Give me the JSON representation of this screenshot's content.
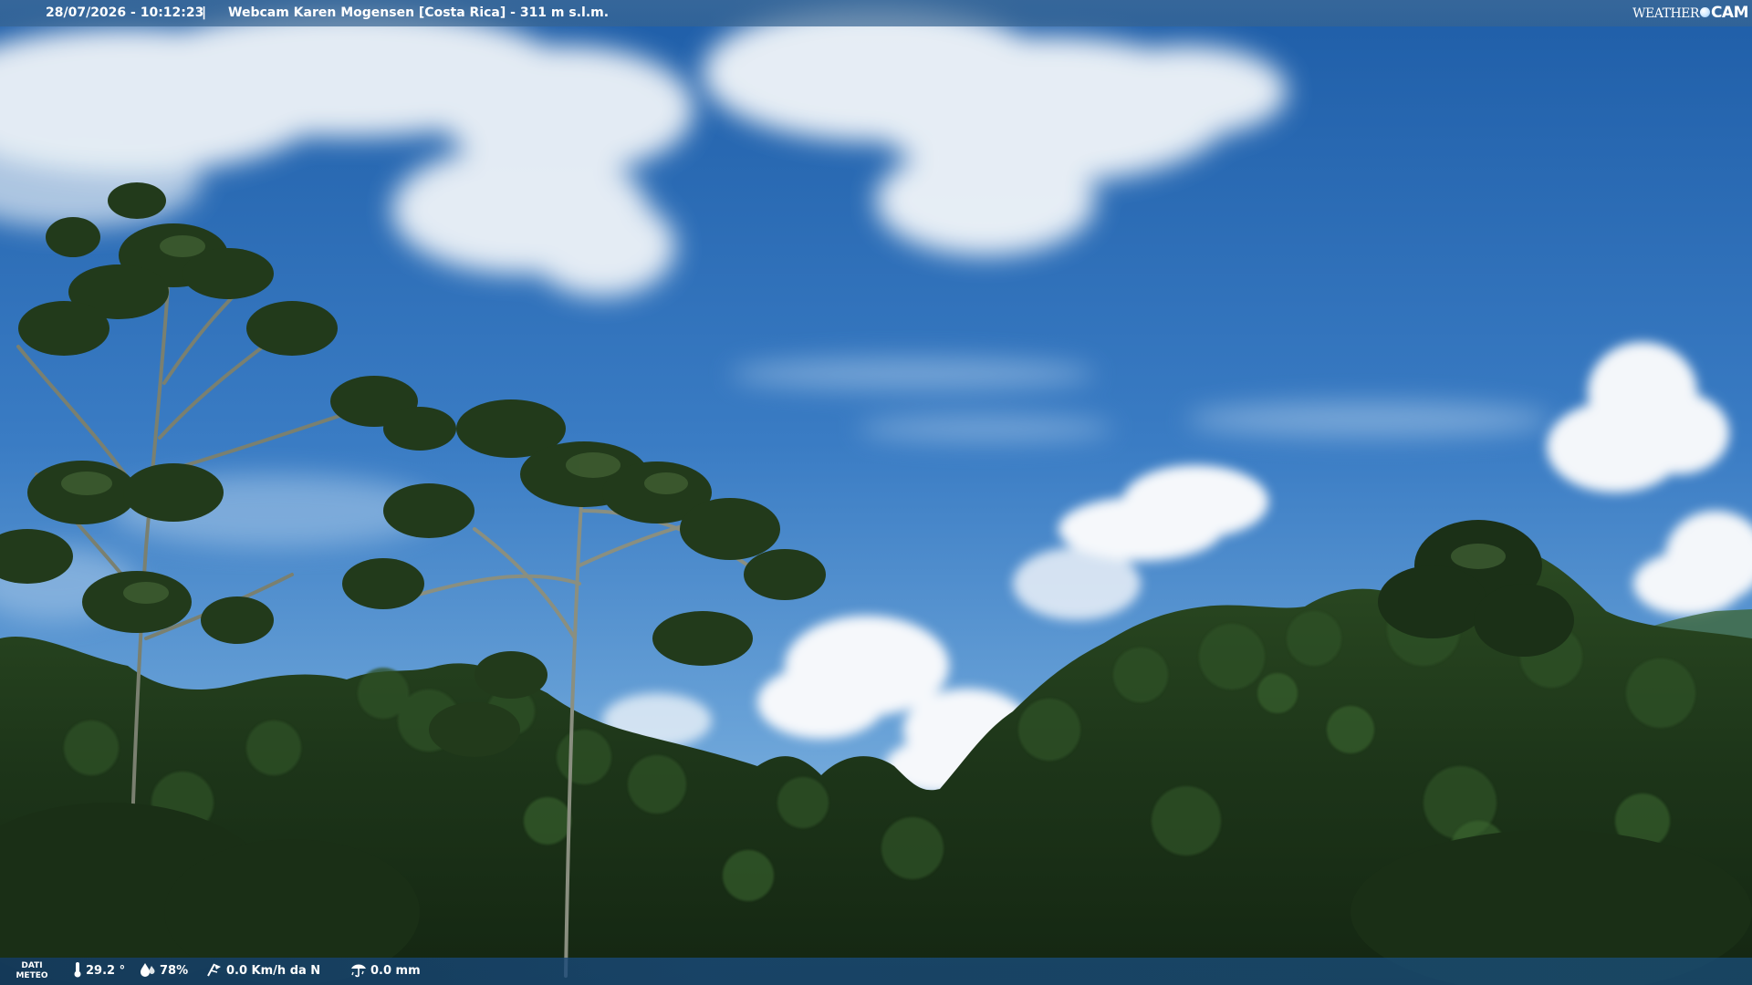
{
  "overlay": {
    "datetime": "28/07/2026 - 10:12:23",
    "separator": "|",
    "title": "Webcam Karen Mogensen [Costa Rica]  - 311 m s.l.m.",
    "logo": {
      "part1": "WEATHER",
      "part2": "CAM"
    }
  },
  "weather": {
    "label_line1": "DATI",
    "label_line2": "METEO",
    "temperature": "29.2 °",
    "humidity": "78%",
    "wind": "0.0 Km/h da N",
    "rain": "0.0 mm"
  },
  "icons": {
    "temperature": "thermometer-icon",
    "humidity": "humidity-drop-icon",
    "wind": "wind-icon",
    "rain": "rain-gauge-icon"
  },
  "colors": {
    "sky_top": "#1f5ea8",
    "sky_bottom": "#7fb3e0",
    "foliage": "#1c3318",
    "bar": "#3c6996"
  }
}
